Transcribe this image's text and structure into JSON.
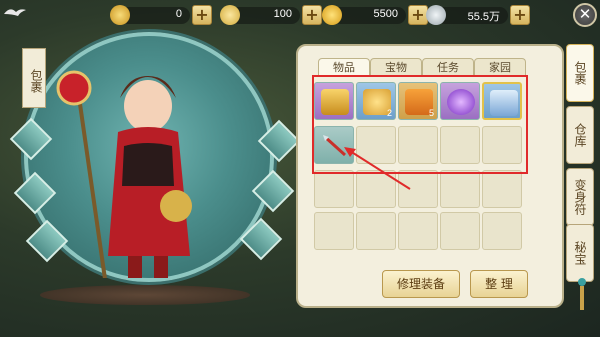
{
  "resources": [
    {
      "icon": "gold-ingot-icon",
      "value": "0",
      "color": "#d8a92a"
    },
    {
      "icon": "silver-ingot-icon",
      "value": "100",
      "color": "#e2c25a"
    },
    {
      "icon": "gold-coin-icon",
      "value": "5500",
      "color": "#e8b82e"
    },
    {
      "icon": "silver-coin-icon",
      "value": "55.5万",
      "color": "#c9d2d6"
    }
  ],
  "plus_symbol": "+",
  "close_symbol": "✕",
  "bag_tag": "包裹",
  "tabs": [
    "物品",
    "宝物",
    "任务",
    "家园"
  ],
  "inventory": [
    {
      "icon": "treasure-chest-icon",
      "count": "",
      "color": "purple"
    },
    {
      "icon": "gold-ingot-bowl-icon",
      "count": "2",
      "color": "blue"
    },
    {
      "icon": "orange-pouch-icon",
      "count": "5",
      "color": "orange"
    },
    {
      "icon": "purple-orb-icon",
      "count": "",
      "color": "purple"
    },
    {
      "icon": "blue-armor-icon",
      "count": "",
      "color": "blue"
    },
    {
      "icon": "spear-icon",
      "count": "",
      "color": "teal"
    }
  ],
  "buttons": {
    "repair": "修理装备",
    "sort": "整 理"
  },
  "side_tabs": [
    "包裹",
    "仓库",
    "变身符",
    "秘宝"
  ],
  "colors": {
    "highlight": "#e02a2a",
    "panel": "#f3efde",
    "accent": "#d5b35a"
  }
}
